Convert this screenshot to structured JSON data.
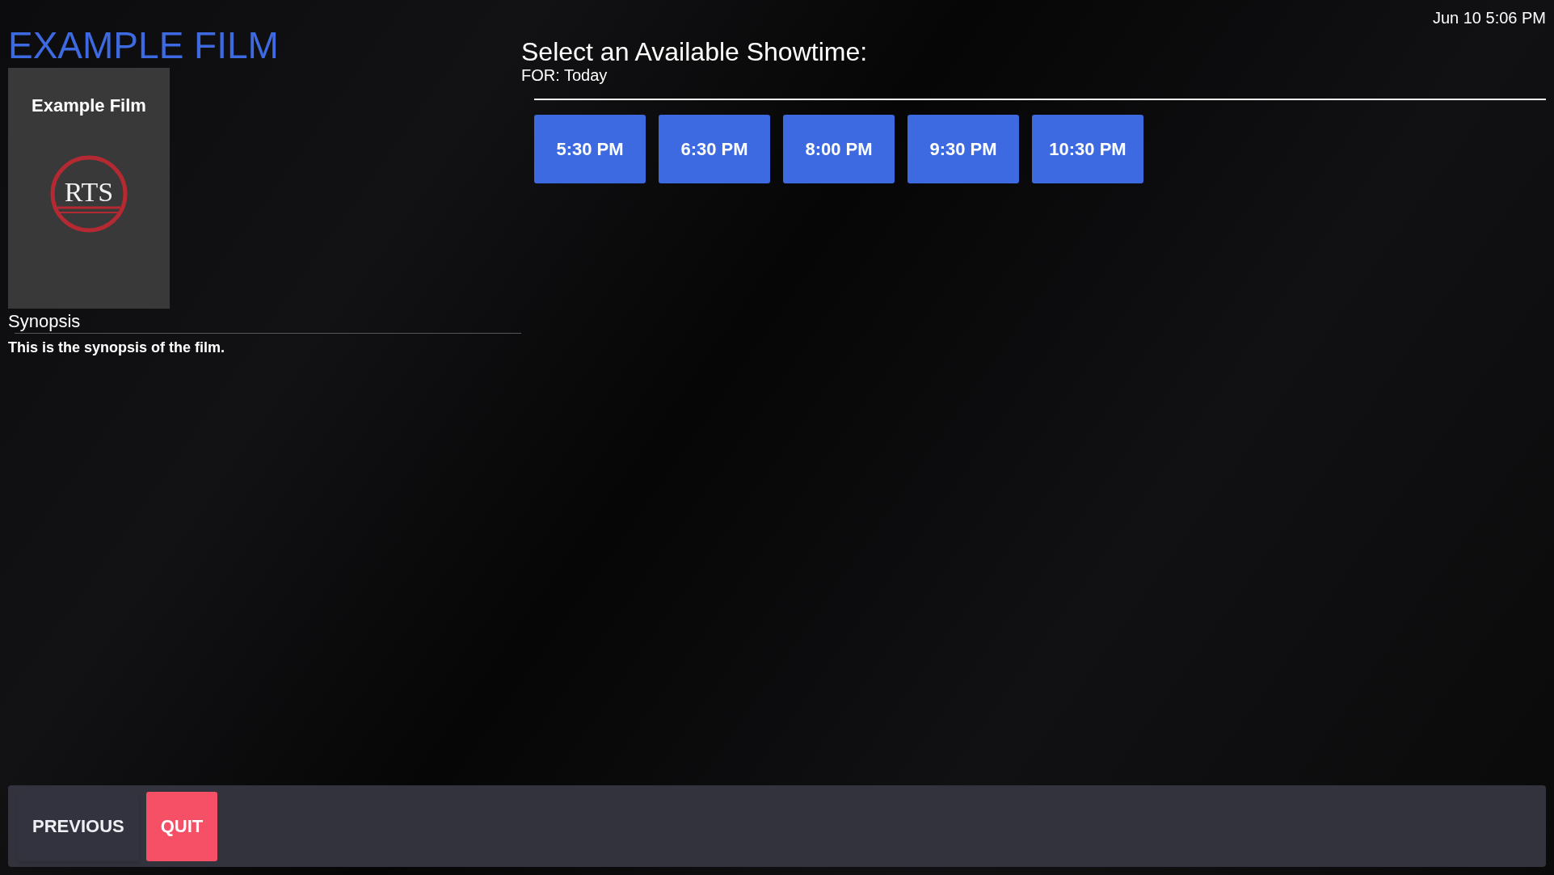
{
  "clock": "Jun 10 5:06 PM",
  "film": {
    "title": "EXAMPLE FILM",
    "poster": {
      "title": "Example Film",
      "logo_text": "RTS"
    },
    "synopsis_heading": "Synopsis",
    "synopsis": "This is the synopsis of the film."
  },
  "showtimes": {
    "heading": "Select an Available Showtime:",
    "subheading": "FOR: Today",
    "times": [
      "5:30 PM",
      "6:30 PM",
      "8:00 PM",
      "9:30 PM",
      "10:30 PM"
    ]
  },
  "footer": {
    "buttons": [
      {
        "label": "PREVIOUS",
        "kind": "plain"
      },
      {
        "label": "QUIT",
        "kind": "danger"
      }
    ]
  }
}
